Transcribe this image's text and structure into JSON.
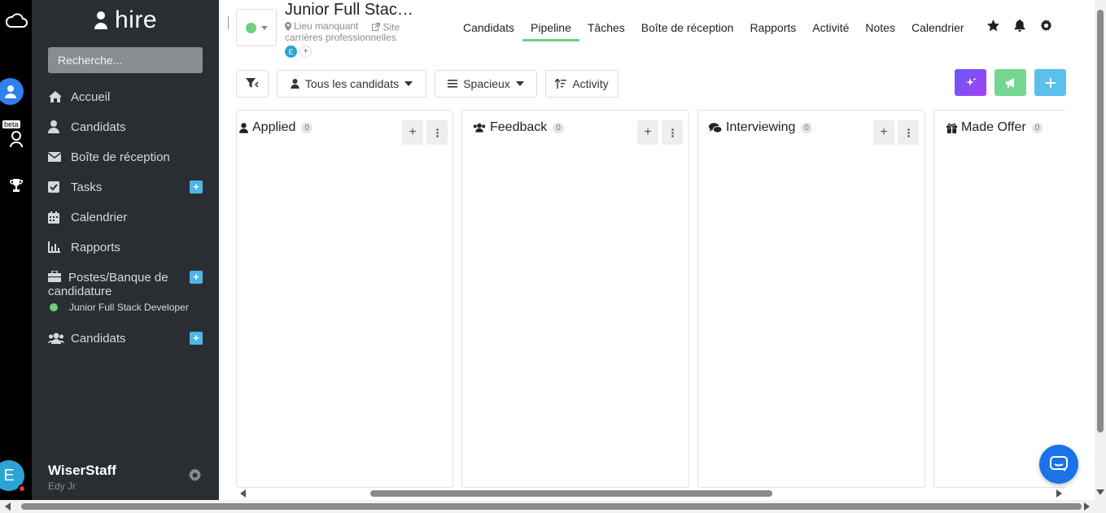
{
  "sidebar": {
    "brand": "hire",
    "search_placeholder": "Recherche...",
    "items": [
      {
        "label": "Accueil",
        "icon": "home-icon"
      },
      {
        "label": "Candidats",
        "icon": "user-icon"
      },
      {
        "label": "Boîte de réception",
        "icon": "envelope-icon"
      },
      {
        "label": "Tasks",
        "icon": "checkbox-icon"
      },
      {
        "label": "Calendrier",
        "icon": "calendar-icon"
      },
      {
        "label": "Rapports",
        "icon": "chart-icon"
      },
      {
        "label": "Postes/Banque de candidature",
        "icon": "briefcase-icon"
      },
      {
        "label": "Candidats",
        "icon": "users-icon"
      }
    ],
    "sub_item": "Junior Full Stack Developer",
    "plus": "+",
    "profile": {
      "name": "WiserStaff",
      "sub": "Edy Jr",
      "avatar": "E"
    }
  },
  "rail": {
    "beta": "beta"
  },
  "header": {
    "job_title": "Junior Full Stac…",
    "location": "Lieu manquant",
    "site": "Site carrières professionnelles",
    "avatar": "E",
    "add": "+",
    "tabs": [
      "Candidats",
      "Pipeline",
      "Tâches",
      "Boîte de réception",
      "Rapports",
      "Activité",
      "Notes",
      "Calendrier"
    ],
    "active_tab": "Pipeline"
  },
  "toolbar": {
    "candidates_filter": "Tous les candidats",
    "view": "Spacieux",
    "sort": "Activity"
  },
  "columns": [
    {
      "name": "Applied",
      "count": "0",
      "icon": "user-icon"
    },
    {
      "name": "Feedback",
      "count": "0",
      "icon": "users-icon"
    },
    {
      "name": "Interviewing",
      "count": "0",
      "icon": "comments-icon"
    },
    {
      "name": "Made Offer",
      "count": "0",
      "icon": "gift-icon"
    }
  ],
  "colors": {
    "sidebar_bg": "#2a2e33",
    "accent_green": "#6fcf7c",
    "accent_blue": "#4db6e6",
    "ai_purple": "#8a3ffc"
  }
}
